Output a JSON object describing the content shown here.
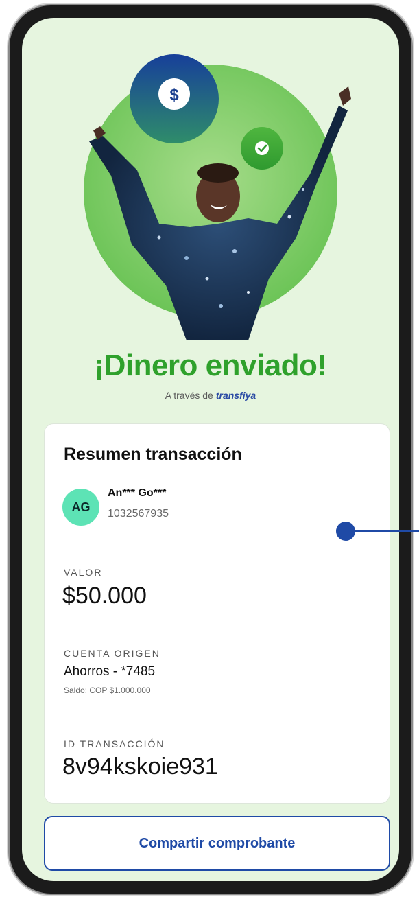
{
  "success": {
    "title": "¡Dinero enviado!",
    "via_prefix": "A través de",
    "brand": "transfiya"
  },
  "hero": {
    "coin_symbol": "$",
    "check_icon": "check-icon"
  },
  "summary": {
    "title": "Resumen transacción",
    "recipient": {
      "initials": "AG",
      "name": "An*** Go***",
      "id_number": "1032567935"
    },
    "value_label": "VALOR",
    "value": "$50.000",
    "origin_label": "CUENTA ORIGEN",
    "origin_account": "Ahorros - *7485",
    "origin_balance": "Saldo: COP $1.000.000",
    "tx_label": "ID TRANSACCIÓN",
    "tx_id": "8v94kskoie931"
  },
  "actions": {
    "share_label": "Compartir comprobante"
  },
  "colors": {
    "screen_bg": "#e6f5df",
    "headline_green": "#2fa12c",
    "accent_blue": "#1f4aa6",
    "avatar_mint": "#5de3b5"
  }
}
